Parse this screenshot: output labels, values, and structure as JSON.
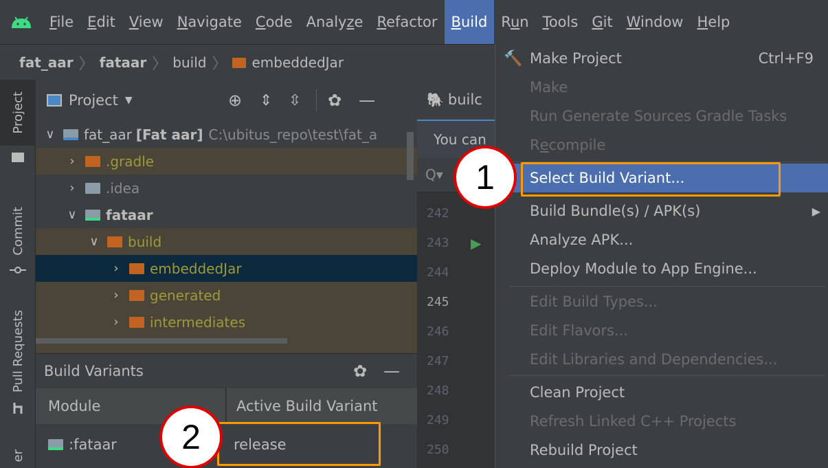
{
  "menubar": {
    "items": [
      {
        "mnemonic": "F",
        "rest": "ile"
      },
      {
        "mnemonic": "E",
        "rest": "dit"
      },
      {
        "mnemonic": "V",
        "rest": "iew"
      },
      {
        "mnemonic": "N",
        "rest": "avigate"
      },
      {
        "mnemonic": "C",
        "rest": "ode"
      },
      {
        "mnemonic": "",
        "rest": "Analyze"
      },
      {
        "mnemonic": "R",
        "rest": "efactor"
      },
      {
        "mnemonic": "B",
        "rest": "uild"
      },
      {
        "mnemonic": "",
        "rest": "Run"
      },
      {
        "mnemonic": "T",
        "rest": "ools"
      },
      {
        "mnemonic": "G",
        "rest": "it"
      },
      {
        "mnemonic": "W",
        "rest": "indow"
      },
      {
        "mnemonic": "H",
        "rest": "elp"
      }
    ],
    "analyze_label": "Analy",
    "analyze_u": "z",
    "analyze_rest": "e",
    "run_r": "R",
    "run_u": "u",
    "run_n": "n"
  },
  "breadcrumb": {
    "items": [
      "fat_aar",
      "fataar",
      "build",
      "embeddedJar"
    ]
  },
  "left_stripe": {
    "project": "Project",
    "commit": "Commit",
    "pull_requests": "Pull Requests",
    "bottom": "er"
  },
  "project_panel": {
    "title": "Project",
    "tree": [
      {
        "name": "fat_aar",
        "bold_suffix": "[Fat aar]",
        "path": "C:\\ubitus_repo\\test\\fat_a"
      },
      {
        "name": ".gradle"
      },
      {
        "name": ".idea"
      },
      {
        "name": "fataar"
      },
      {
        "name": "build"
      },
      {
        "name": "embeddedJar"
      },
      {
        "name": "generated"
      },
      {
        "name": "intermediates"
      }
    ]
  },
  "build_variants": {
    "title": "Build Variants",
    "col_module": "Module",
    "col_variant": "Active Build Variant",
    "rows": [
      {
        "module": ":fataar",
        "variant": "release"
      }
    ]
  },
  "editor": {
    "tab_label": "builc",
    "notice": "You can",
    "line_numbers": [
      "242",
      "243",
      "244",
      "245",
      "246",
      "247",
      "248",
      "249",
      "250"
    ],
    "current_line": "245"
  },
  "build_menu": {
    "items": [
      {
        "label": "Make Project",
        "shortcut": "Ctrl+F9"
      },
      {
        "label": "Make"
      },
      {
        "label": "Run Generate Sources Gradle Tasks"
      },
      {
        "label_pre": "R",
        "label_u": "e",
        "label_post": "compile"
      },
      {
        "label": "Select Build Variant..."
      },
      {
        "label": "Build Bundle(s) / APK(s)"
      },
      {
        "label": "Analyze APK..."
      },
      {
        "label": "Deploy Module to App Engine..."
      },
      {
        "label": "Edit Build Types..."
      },
      {
        "label": "Edit Flavors..."
      },
      {
        "label": "Edit Libraries and Dependencies..."
      },
      {
        "label": "Clean Project"
      },
      {
        "label": "Refresh Linked C++ Projects"
      },
      {
        "label": "Rebuild Project"
      }
    ]
  },
  "annotations": {
    "step1": "1",
    "step2": "2"
  },
  "colors": {
    "accent": "#4b6eaf",
    "highlight_box": "#ff9900",
    "circle_border": "#e00000",
    "folder": "#c16321",
    "excluded_text": "#9e9a3a"
  }
}
